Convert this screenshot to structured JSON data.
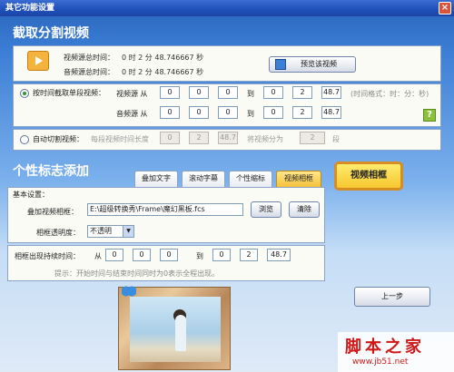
{
  "window": {
    "title": "其它功能设置",
    "close": "×"
  },
  "cut_section": {
    "title": "截取分割视频",
    "source_video_time_label": "视频源总时间：",
    "source_video_time_value": "0  时 2  分 48.746667 秒",
    "source_audio_time_label": "音频源总时间：",
    "source_audio_time_value": "0  时 2  分 48.746667 秒",
    "preview_button": "预览该视频",
    "mode_time_label": "按时间截取单段视频：",
    "video_source_label": "视频源  从",
    "audio_source_label": "音频源  从",
    "to_label": "到",
    "video_from": [
      "0",
      "0",
      "0"
    ],
    "video_to": [
      "0",
      "2",
      "48.7"
    ],
    "audio_from": [
      "0",
      "0",
      "0"
    ],
    "audio_to": [
      "0",
      "2",
      "48.7"
    ],
    "time_format_hint": "(时间格式：时：分：秒)",
    "mode_auto_label": "自动切割视频：",
    "segment_length_label": "每段视频时间长度",
    "segment_values": [
      "0",
      "2",
      "48.7"
    ],
    "split_into_label": "将视频分为",
    "split_count": "2",
    "split_unit": "段",
    "help_icon_glyph": "?"
  },
  "personal_section": {
    "title": "个性标志添加",
    "tabs": [
      "叠加文字",
      "滚动字幕",
      "个性缩标",
      "视频相框"
    ],
    "active_tab": "视频相框",
    "callout": "视频相框",
    "basic_settings_label": "基本设置：",
    "overlay_frame_label": "叠加视频相框：",
    "overlay_frame_path": "E:\\超级转换秀\\Frame\\魔幻黑板.fcs",
    "browse_button": "浏览",
    "clear_button": "清除",
    "opacity_label": "相框透明度：",
    "opacity_value": "不透明",
    "duration_label": "相框出现持续时间：",
    "from_label": "从",
    "to_label": "到",
    "from_values": [
      "0",
      "0",
      "0"
    ],
    "to_values": [
      "0",
      "2",
      "48.7"
    ],
    "hint": "提示：开始时间与结束时间同时为0表示全程出现。",
    "prev_button": "上一步"
  },
  "watermark": {
    "brand": "脚本之家",
    "url": "www.jb51.net"
  },
  "colors": {
    "title_blue": "#2f6cc4",
    "tab_active": "#f4c23d",
    "callout_border": "#d78d23"
  }
}
